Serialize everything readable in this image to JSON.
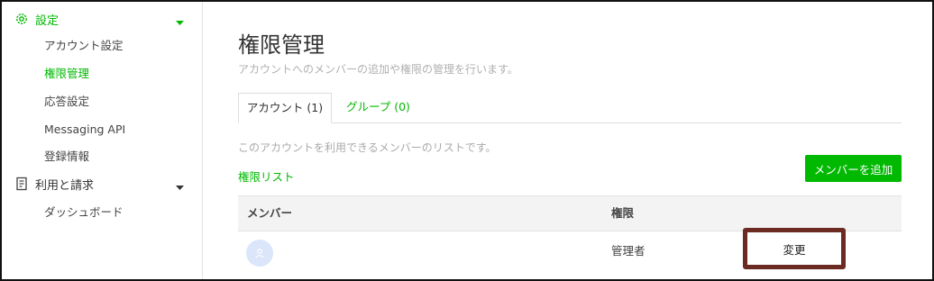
{
  "sidebar": {
    "sections": [
      {
        "label": "設定",
        "icon": "gear-icon"
      },
      {
        "label": "利用と請求",
        "icon": "document-icon"
      }
    ],
    "settings_items": [
      "アカウント設定",
      "権限管理",
      "応答設定",
      "Messaging API",
      "登録情報"
    ],
    "billing_items": [
      "ダッシュボード"
    ],
    "active_item": "権限管理"
  },
  "page": {
    "title": "権限管理",
    "description": "アカウントへのメンバーの追加や権限の管理を行います。"
  },
  "tabs": [
    {
      "label": "アカウント (1)",
      "active": true
    },
    {
      "label": "グループ (0)",
      "active": false
    }
  ],
  "content": {
    "list_description": "このアカウントを利用できるメンバーのリストです。",
    "permission_list_link": "権限リスト",
    "add_member_button": "メンバーを追加"
  },
  "table": {
    "headers": {
      "member": "メンバー",
      "permission": "権限"
    },
    "rows": [
      {
        "role": "管理者",
        "action": "変更"
      }
    ]
  },
  "colors": {
    "accent": "#00b900",
    "highlight_border": "#6b2a22"
  }
}
